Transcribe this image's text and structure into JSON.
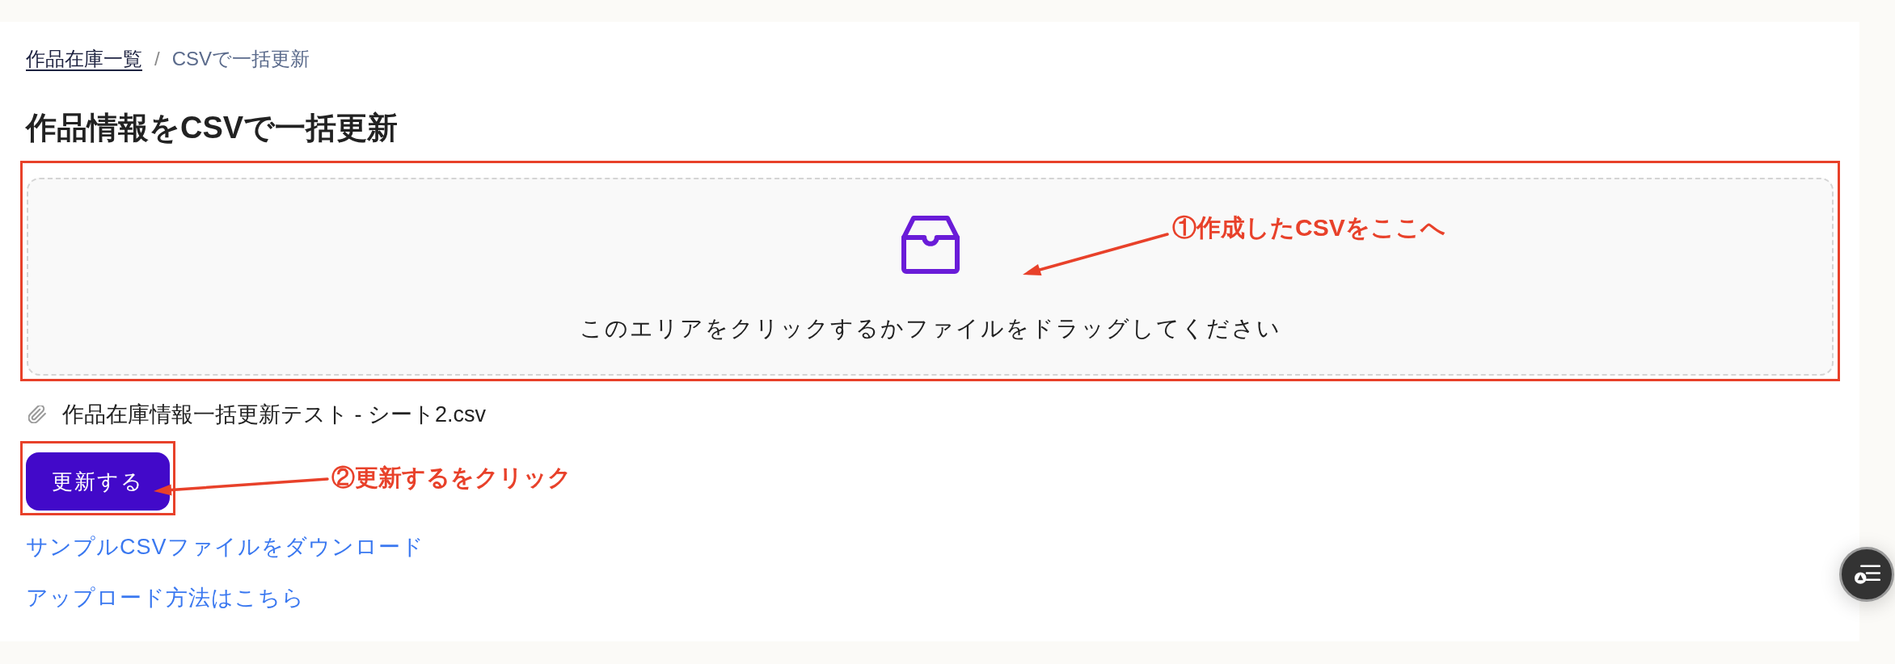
{
  "breadcrumb": [
    {
      "label": "作品在庫一覧",
      "kind": "link"
    },
    {
      "label": "CSVで一括更新",
      "kind": "current"
    }
  ],
  "breadcrumb_separator": "/",
  "title": "作品情報をCSVで一括更新",
  "dropzone": {
    "prompt": "このエリアをクリックするかファイルをドラッグしてください",
    "callout": "①作成したCSVをここへ"
  },
  "attached_file": {
    "name": "作品在庫情報一括更新テスト - シート2.csv"
  },
  "submit_button": {
    "label": "更新する",
    "callout": "②更新するをクリック"
  },
  "links": [
    {
      "label": "サンプルCSVファイルをダウンロード"
    },
    {
      "label": "アップロード方法はこちら"
    }
  ]
}
